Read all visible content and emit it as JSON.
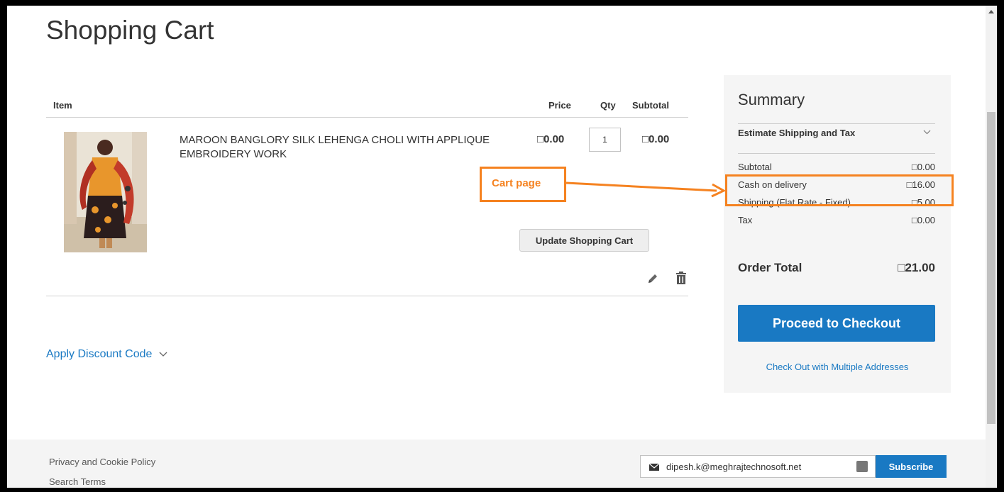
{
  "page": {
    "title": "Shopping Cart"
  },
  "cart": {
    "headers": {
      "item": "Item",
      "price": "Price",
      "qty": "Qty",
      "subtotal": "Subtotal"
    },
    "items": [
      {
        "name": "MAROON BANGLORY SILK LEHENGA CHOLI WITH APPLIQUE EMBROIDERY WORK",
        "price": "□0.00",
        "qty": "1",
        "subtotal": "□0.00",
        "image_icon": "product-image"
      }
    ],
    "update_label": "Update Shopping Cart",
    "discount_label": "Apply Discount Code"
  },
  "summary": {
    "title": "Summary",
    "estimate_label": "Estimate Shipping and Tax",
    "rows": [
      {
        "label": "Subtotal",
        "amount": "□0.00"
      },
      {
        "label": "Cash on delivery",
        "amount": "□16.00"
      },
      {
        "label": "Shipping (Flat Rate - Fixed)",
        "amount": "□5.00"
      },
      {
        "label": "Tax",
        "amount": "□0.00"
      }
    ],
    "order_total_label": "Order Total",
    "order_total_amount": "□21.00",
    "checkout_label": "Proceed to Checkout",
    "multi_address_label": "Check Out with Multiple Addresses"
  },
  "annotation": {
    "label": "Cart page",
    "color": "#f58220"
  },
  "footer": {
    "links": [
      "Privacy and Cookie Policy",
      "Search Terms"
    ],
    "newsletter_value": "dipesh.k@meghrajtechnosoft.net",
    "subscribe_label": "Subscribe"
  },
  "colors": {
    "accent": "#1979c3",
    "annotation": "#f58220",
    "summary_bg": "#f5f5f5"
  }
}
